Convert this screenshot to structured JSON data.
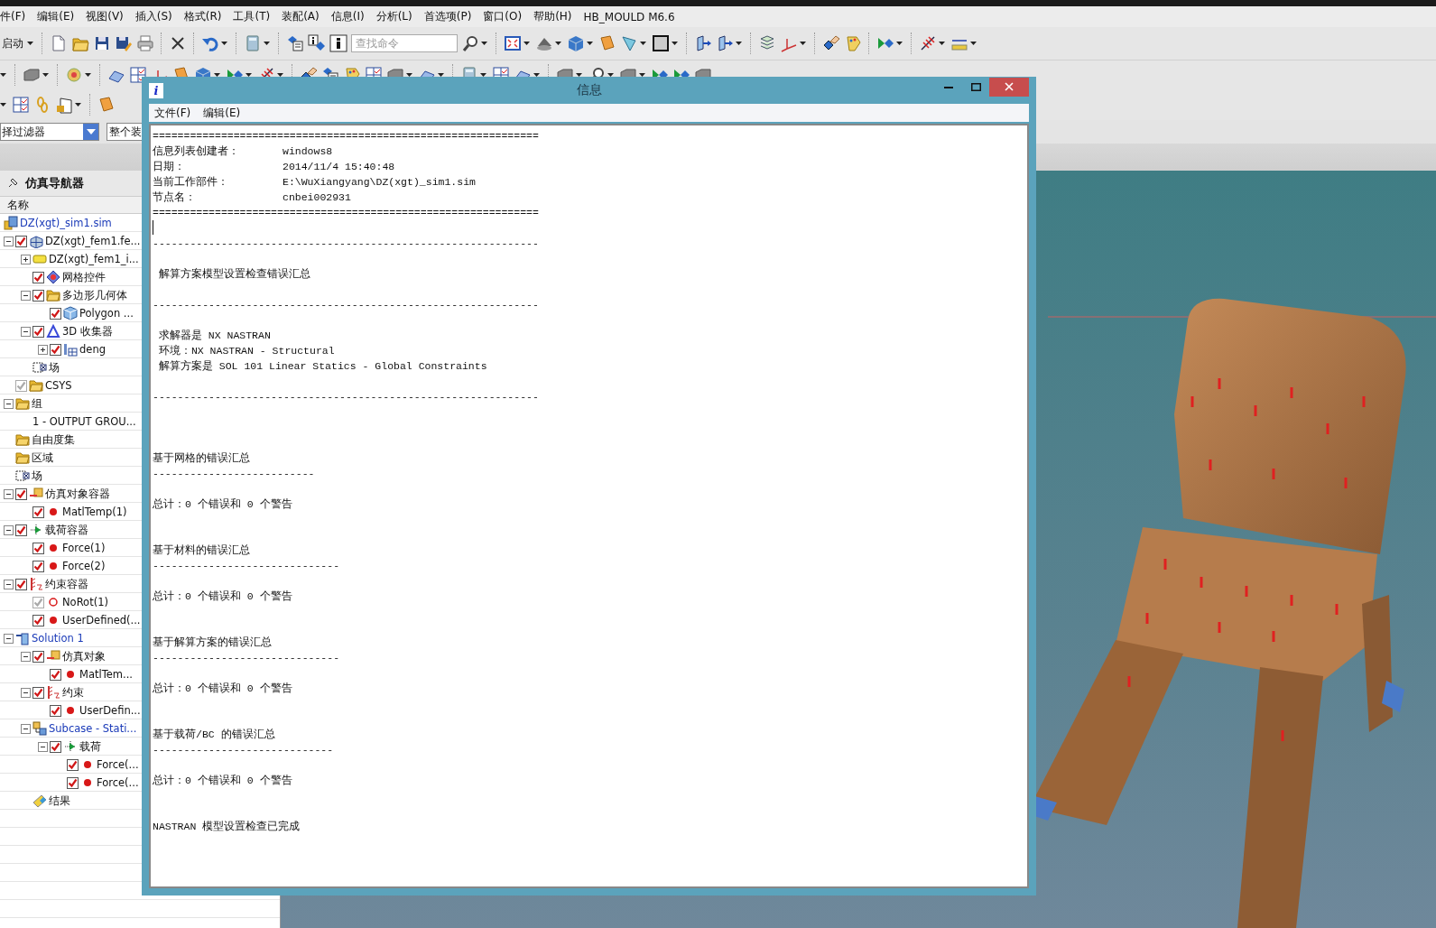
{
  "menu_bar": [
    "件(F)",
    "编辑(E)",
    "视图(V)",
    "插入(S)",
    "格式(R)",
    "工具(T)",
    "装配(A)",
    "信息(I)",
    "分析(L)",
    "首选项(P)",
    "窗口(O)",
    "帮助(H)",
    "HB_MOULD M6.6"
  ],
  "toolbar": {
    "start_label": "启动",
    "search": {
      "placeholder": "查找命令"
    }
  },
  "selection_bar": {
    "filter": "择过滤器",
    "scope": "整个装"
  },
  "navigator": {
    "title": "仿真导航器",
    "column": "名称",
    "tree": [
      {
        "label": "DZ(xgt)_sim1.sim",
        "kind": "sim",
        "children": [
          {
            "label": "DZ(xgt)_fem1.fe...",
            "kind": "fem",
            "expanded": true,
            "checked": true,
            "disabled": false,
            "children": [
              {
                "label": "DZ(xgt)_fem1_i...",
                "kind": "part",
                "expanded": false
              },
              {
                "label": "网格控件",
                "kind": "mesh_control",
                "checked": true,
                "disabled": false
              },
              {
                "label": "多边形几何体",
                "kind": "folder",
                "expanded": true,
                "checked": true,
                "disabled": false,
                "children": [
                  {
                    "label": "Polygon ...",
                    "kind": "polygon",
                    "checked": true,
                    "disabled": false
                  }
                ]
              },
              {
                "label": "3D 收集器",
                "kind": "collector",
                "expanded": true,
                "checked": true,
                "disabled": false,
                "children": [
                  {
                    "label": "deng",
                    "kind": "mesh_set",
                    "expanded": false,
                    "checked": true,
                    "disabled": false
                  }
                ]
              },
              {
                "label": "场",
                "kind": "field"
              }
            ]
          },
          {
            "label": "CSYS",
            "kind": "folder",
            "checked": true,
            "disabled": true
          },
          {
            "label": "组",
            "kind": "folder",
            "expanded": true,
            "children": [
              {
                "label": "1 - OUTPUT GROU...",
                "kind": "plain"
              }
            ]
          },
          {
            "label": "自由度集",
            "kind": "folder"
          },
          {
            "label": "区域",
            "kind": "folder"
          },
          {
            "label": "场",
            "kind": "field"
          },
          {
            "label": "仿真对象容器",
            "kind": "sim_object",
            "expanded": true,
            "checked": true,
            "disabled": false,
            "children": [
              {
                "label": "MatlTemp(1)",
                "kind": "dot",
                "checked": true,
                "disabled": false
              }
            ]
          },
          {
            "label": "载荷容器",
            "kind": "load",
            "expanded": true,
            "checked": true,
            "disabled": false,
            "children": [
              {
                "label": "Force(1)",
                "kind": "dot",
                "checked": true,
                "disabled": false
              },
              {
                "label": "Force(2)",
                "kind": "dot",
                "checked": true,
                "disabled": false
              }
            ]
          },
          {
            "label": "约束容器",
            "kind": "constraint",
            "expanded": true,
            "checked": true,
            "disabled": false,
            "children": [
              {
                "label": "NoRot(1)",
                "kind": "ring",
                "checked": true,
                "disabled": true
              },
              {
                "label": "UserDefined(...",
                "kind": "dot",
                "checked": true,
                "disabled": false
              }
            ]
          },
          {
            "label": "Solution 1",
            "kind": "solution",
            "expanded": true,
            "children": [
              {
                "label": "仿真对象",
                "kind": "sim_object",
                "expanded": true,
                "checked": true,
                "disabled": false,
                "children": [
                  {
                    "label": "MatlTem...",
                    "kind": "dot",
                    "checked": true,
                    "disabled": false
                  }
                ]
              },
              {
                "label": "约束",
                "kind": "constraint",
                "expanded": true,
                "checked": true,
                "disabled": false,
                "children": [
                  {
                    "label": "UserDefin...",
                    "kind": "dot",
                    "checked": true,
                    "disabled": false
                  }
                ]
              },
              {
                "label": "Subcase - Stati...",
                "kind": "subcase",
                "expanded": true,
                "children": [
                  {
                    "label": "载荷",
                    "kind": "load",
                    "expanded": true,
                    "checked": true,
                    "disabled": false,
                    "children": [
                      {
                        "label": "Force(...",
                        "kind": "dot",
                        "checked": true,
                        "disabled": false
                      },
                      {
                        "label": "Force(...",
                        "kind": "dot",
                        "checked": true,
                        "disabled": false
                      }
                    ]
                  }
                ]
              },
              {
                "label": "结果",
                "kind": "results"
              }
            ]
          }
        ]
      }
    ]
  },
  "info_window": {
    "title": "信息",
    "icon": "i",
    "menu": [
      "文件(F)",
      "编辑(E)"
    ],
    "lines": [
      {
        "kind": "rule",
        "text": "=============================================================="
      },
      {
        "kind": "field",
        "label": "信息列表创建者：",
        "value": "windows8"
      },
      {
        "kind": "field",
        "label": "日期：",
        "value": "2014/11/4 15:40:48"
      },
      {
        "kind": "field",
        "label": "当前工作部件：",
        "value": "E:\\WuXiangyang\\DZ(xgt)_sim1.sim"
      },
      {
        "kind": "field",
        "label": "节点名：",
        "value": "cnbei002931"
      },
      {
        "kind": "rule",
        "text": "=============================================================="
      },
      {
        "kind": "cursor"
      },
      {
        "kind": "rule",
        "text": "--------------------------------------------------------------"
      },
      {
        "kind": "blank"
      },
      {
        "kind": "text",
        "text": " 解算方案模型设置检查错误汇总"
      },
      {
        "kind": "blank"
      },
      {
        "kind": "rule",
        "text": "--------------------------------------------------------------"
      },
      {
        "kind": "blank"
      },
      {
        "kind": "text",
        "text": " 求解器是 NX NASTRAN"
      },
      {
        "kind": "text",
        "text": " 环境：NX NASTRAN - Structural"
      },
      {
        "kind": "text",
        "text": " 解算方案是 SOL 101 Linear Statics - Global Constraints"
      },
      {
        "kind": "blank"
      },
      {
        "kind": "rule",
        "text": "--------------------------------------------------------------"
      },
      {
        "kind": "blank"
      },
      {
        "kind": "blank"
      },
      {
        "kind": "blank"
      },
      {
        "kind": "text",
        "text": "基于网格的错误汇总"
      },
      {
        "kind": "rule",
        "text": "--------------------------"
      },
      {
        "kind": "blank"
      },
      {
        "kind": "text",
        "text": "总计：0 个错误和 0 个警告"
      },
      {
        "kind": "blank"
      },
      {
        "kind": "blank"
      },
      {
        "kind": "text",
        "text": "基于材料的错误汇总"
      },
      {
        "kind": "rule",
        "text": "------------------------------"
      },
      {
        "kind": "blank"
      },
      {
        "kind": "text",
        "text": "总计：0 个错误和 0 个警告"
      },
      {
        "kind": "blank"
      },
      {
        "kind": "blank"
      },
      {
        "kind": "text",
        "text": "基于解算方案的错误汇总"
      },
      {
        "kind": "rule",
        "text": "------------------------------"
      },
      {
        "kind": "blank"
      },
      {
        "kind": "text",
        "text": "总计：0 个错误和 0 个警告"
      },
      {
        "kind": "blank"
      },
      {
        "kind": "blank"
      },
      {
        "kind": "text",
        "text": "基于载荷/BC 的错误汇总"
      },
      {
        "kind": "rule",
        "text": "-----------------------------"
      },
      {
        "kind": "blank"
      },
      {
        "kind": "text",
        "text": "总计：0 个错误和 0 个警告"
      },
      {
        "kind": "blank"
      },
      {
        "kind": "blank"
      },
      {
        "kind": "text",
        "text": "NASTRAN 模型设置检查已完成"
      }
    ]
  }
}
